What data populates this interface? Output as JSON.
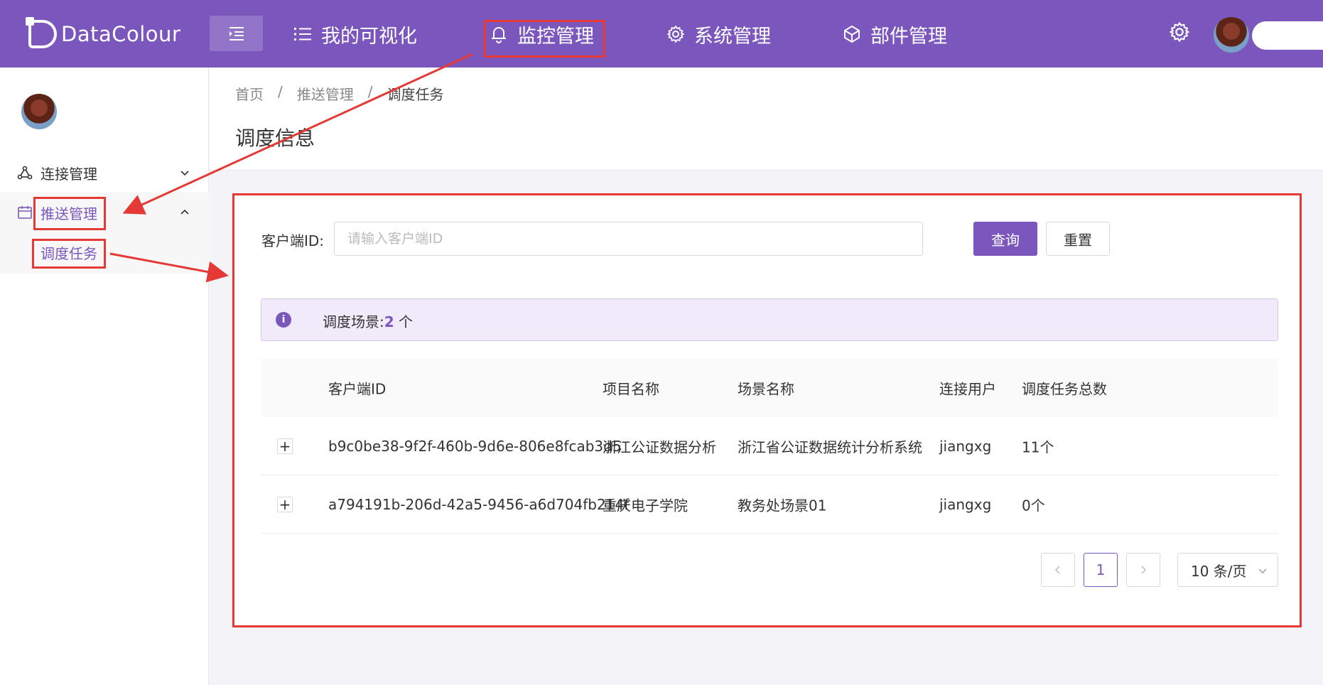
{
  "topbar": {
    "logo_text": "DataColour",
    "nav": [
      {
        "label": "我的可视化",
        "icon": "list-icon"
      },
      {
        "label": "监控管理",
        "icon": "bell-icon"
      },
      {
        "label": "系统管理",
        "icon": "gear-icon"
      },
      {
        "label": "部件管理",
        "icon": "cube-icon"
      }
    ],
    "brand_color": "#7b57bd"
  },
  "sidebar": {
    "items": [
      {
        "label": "连接管理",
        "icon": "network-icon",
        "expanded": false
      },
      {
        "label": "推送管理",
        "icon": "calendar-icon",
        "expanded": true
      },
      {
        "label": "调度任务"
      }
    ]
  },
  "breadcrumb": {
    "items": [
      "首页",
      "推送管理",
      "调度任务"
    ],
    "sep": "/"
  },
  "page": {
    "title": "调度信息"
  },
  "filter": {
    "label": "客户端ID:",
    "placeholder": "请输入客户端ID",
    "query_label": "查询",
    "reset_label": "重置"
  },
  "alert": {
    "prefix": "调度场景:",
    "count": "2",
    "suffix": " 个"
  },
  "table": {
    "headers": [
      "客户端ID",
      "项目名称",
      "场景名称",
      "连接用户",
      "调度任务总数"
    ],
    "rows": [
      {
        "expand": "+",
        "client_id": "b9c0be38-9f2f-460b-9d6e-806e8fcab3d5",
        "project": "浙江公证数据分析",
        "scene": "浙江省公证数据统计分析系统",
        "user": "jiangxg",
        "total": "11个"
      },
      {
        "expand": "+",
        "client_id": "a794191b-206d-42a5-9456-a6d704fb214f",
        "project": "重庆电子学院",
        "scene": "教务处场景01",
        "user": "jiangxg",
        "total": "0个"
      }
    ]
  },
  "pagination": {
    "current": "1",
    "page_size": "10 条/页"
  },
  "highlight_color": "#e53935"
}
